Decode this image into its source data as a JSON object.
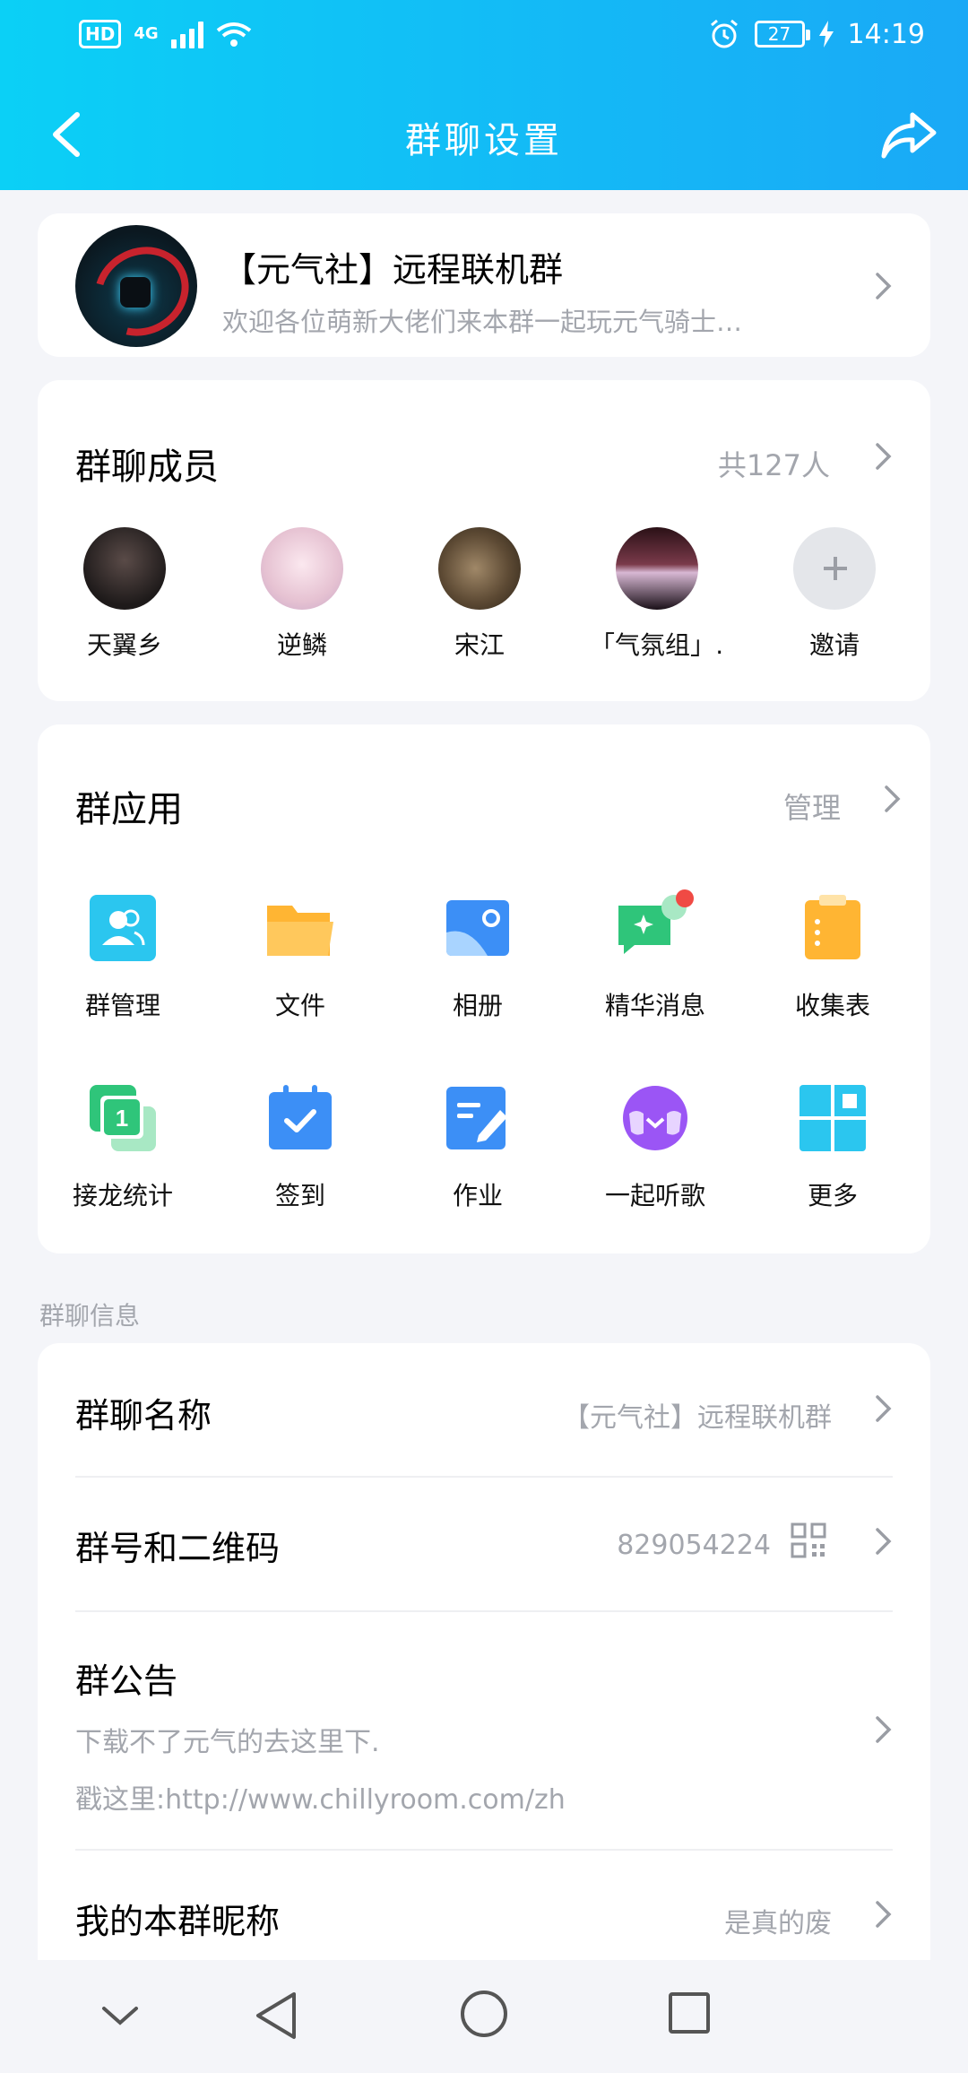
{
  "status_bar": {
    "hd": "HD",
    "network": "4G",
    "battery": "27",
    "time": "14:19"
  },
  "nav": {
    "title": "群聊设置"
  },
  "group": {
    "name": "【元气社】远程联机群",
    "description": "欢迎各位萌新大佬们来本群一起玩元气骑士…"
  },
  "members": {
    "title": "群聊成员",
    "count": "共127人",
    "items": [
      {
        "name": "天翼乡",
        "avatar_color": "#3a3230"
      },
      {
        "name": "逆鳞",
        "avatar_color": "#f1d6e0"
      },
      {
        "name": "宋江",
        "avatar_color": "#6a5a40"
      },
      {
        "name": "「气氛组」…",
        "avatar_color": "#3a1f2a"
      }
    ],
    "invite_label": "邀请"
  },
  "apps": {
    "title": "群应用",
    "manage": "管理",
    "items": [
      {
        "label": "群管理",
        "icon": "group-manage-icon",
        "color": "#2bc6ef"
      },
      {
        "label": "文件",
        "icon": "folder-icon",
        "color": "#ffb533"
      },
      {
        "label": "相册",
        "icon": "album-icon",
        "color": "#3c8ff6"
      },
      {
        "label": "精华消息",
        "icon": "essence-message-icon",
        "color": "#2fc57a"
      },
      {
        "label": "收集表",
        "icon": "clipboard-icon",
        "color": "#ffb533"
      },
      {
        "label": "接龙统计",
        "icon": "relay-icon",
        "color": "#2fc57a"
      },
      {
        "label": "签到",
        "icon": "calendar-check-icon",
        "color": "#3c8ff6"
      },
      {
        "label": "作业",
        "icon": "homework-icon",
        "color": "#3c8ff6"
      },
      {
        "label": "一起听歌",
        "icon": "music-together-icon",
        "color": "#9b55f5"
      },
      {
        "label": "更多",
        "icon": "grid-icon",
        "color": "#2bc6ef"
      }
    ]
  },
  "info": {
    "section_label": "群聊信息",
    "name_label": "群聊名称",
    "name_value": "【元气社】远程联机群",
    "id_label": "群号和二维码",
    "id_value": "829054224",
    "announcement_label": "群公告",
    "announcement_line1": "下载不了元气的去这里下.",
    "announcement_line2": "戳这里:http://www.chillyroom.com/zh",
    "nickname_label": "我的本群昵称",
    "nickname_value": "是真的废"
  },
  "colors": {
    "header_start": "#0bd0f6",
    "header_end": "#1aa9f6",
    "badge_red": "#f04a44"
  }
}
